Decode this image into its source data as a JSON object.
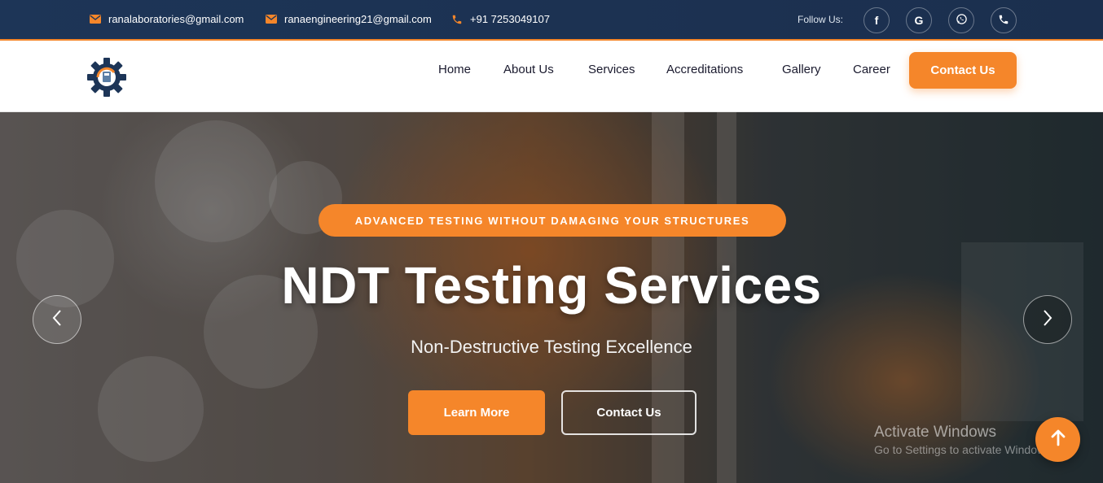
{
  "topbar": {
    "email_1": "ranalaboratories@gmail.com",
    "email_2": "ranaengineering21@gmail.com",
    "phone": "+91 7253049107",
    "follow_label": "Follow Us:",
    "social": [
      {
        "icon": "facebook-icon",
        "glyph": "f"
      },
      {
        "icon": "google-icon",
        "glyph": "G"
      },
      {
        "icon": "whatsapp-icon",
        "glyph": ""
      },
      {
        "icon": "phone-icon",
        "glyph": ""
      }
    ]
  },
  "nav": {
    "items": [
      "Home",
      "About Us",
      "Services",
      "Accreditations",
      "Gallery",
      "Career"
    ],
    "cta": "Contact Us"
  },
  "hero": {
    "tagline": "ADVANCED TESTING WITHOUT DAMAGING YOUR STRUCTURES",
    "title": "NDT Testing Services",
    "subtitle": "Non-Destructive Testing Excellence",
    "primary_button": "Learn More",
    "secondary_button": "Contact Us"
  },
  "watermark": {
    "title": "Activate Windows",
    "subtitle": "Go to Settings to activate Windows."
  },
  "colors": {
    "accent": "#f5862a",
    "topbar": "#1d3557",
    "nav_text": "#1a1a2e"
  }
}
